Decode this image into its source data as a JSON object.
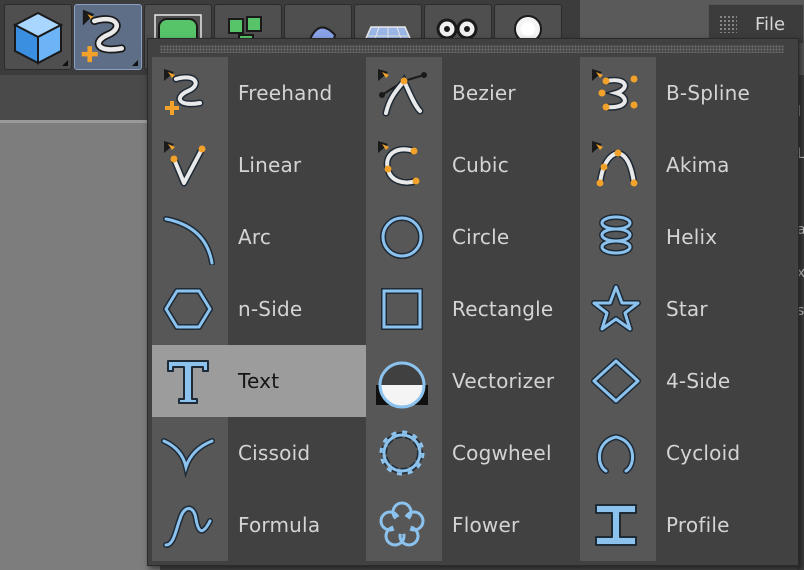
{
  "file_menu": {
    "label": "File"
  },
  "toolbar": {
    "buttons": [
      {
        "name": "cube",
        "active": false
      },
      {
        "name": "spline-pen",
        "active": true
      },
      {
        "name": "subdivision-cage",
        "active": false
      },
      {
        "name": "array-cloner",
        "active": false
      },
      {
        "name": "deformer",
        "active": false
      },
      {
        "name": "floor-plane",
        "active": false
      },
      {
        "name": "camera",
        "active": false
      },
      {
        "name": "light",
        "active": false
      }
    ]
  },
  "spline_menu": {
    "columns": [
      {
        "items": [
          {
            "label": "Freehand",
            "icon": "freehand-icon"
          },
          {
            "label": "Linear",
            "icon": "linear-icon"
          },
          {
            "label": "Arc",
            "icon": "arc-icon"
          },
          {
            "label": "n-Side",
            "icon": "n-side-icon"
          },
          {
            "label": "Text",
            "icon": "text-icon",
            "highlighted": true
          },
          {
            "label": "Cissoid",
            "icon": "cissoid-icon"
          },
          {
            "label": "Formula",
            "icon": "formula-icon"
          }
        ]
      },
      {
        "items": [
          {
            "label": "Bezier",
            "icon": "bezier-icon"
          },
          {
            "label": "Cubic",
            "icon": "cubic-icon"
          },
          {
            "label": "Circle",
            "icon": "circle-icon"
          },
          {
            "label": "Rectangle",
            "icon": "rectangle-icon"
          },
          {
            "label": "Vectorizer",
            "icon": "vectorizer-icon"
          },
          {
            "label": "Cogwheel",
            "icon": "cogwheel-icon"
          },
          {
            "label": "Flower",
            "icon": "flower-icon"
          }
        ]
      },
      {
        "items": [
          {
            "label": "B-Spline",
            "icon": "b-spline-icon"
          },
          {
            "label": "Akima",
            "icon": "akima-icon"
          },
          {
            "label": "Helix",
            "icon": "helix-icon"
          },
          {
            "label": "Star",
            "icon": "star-icon"
          },
          {
            "label": "4-Side",
            "icon": "four-side-icon"
          },
          {
            "label": "Cycloid",
            "icon": "cycloid-icon"
          },
          {
            "label": "Profile",
            "icon": "profile-icon"
          }
        ]
      }
    ]
  },
  "colors": {
    "icon_blue": "#8cc3ee",
    "icon_dark": "#1e2a36",
    "pen_orange": "#f2a22b",
    "highlight_bg": "#9c9c9c",
    "label_text": "#d4d4d4"
  }
}
